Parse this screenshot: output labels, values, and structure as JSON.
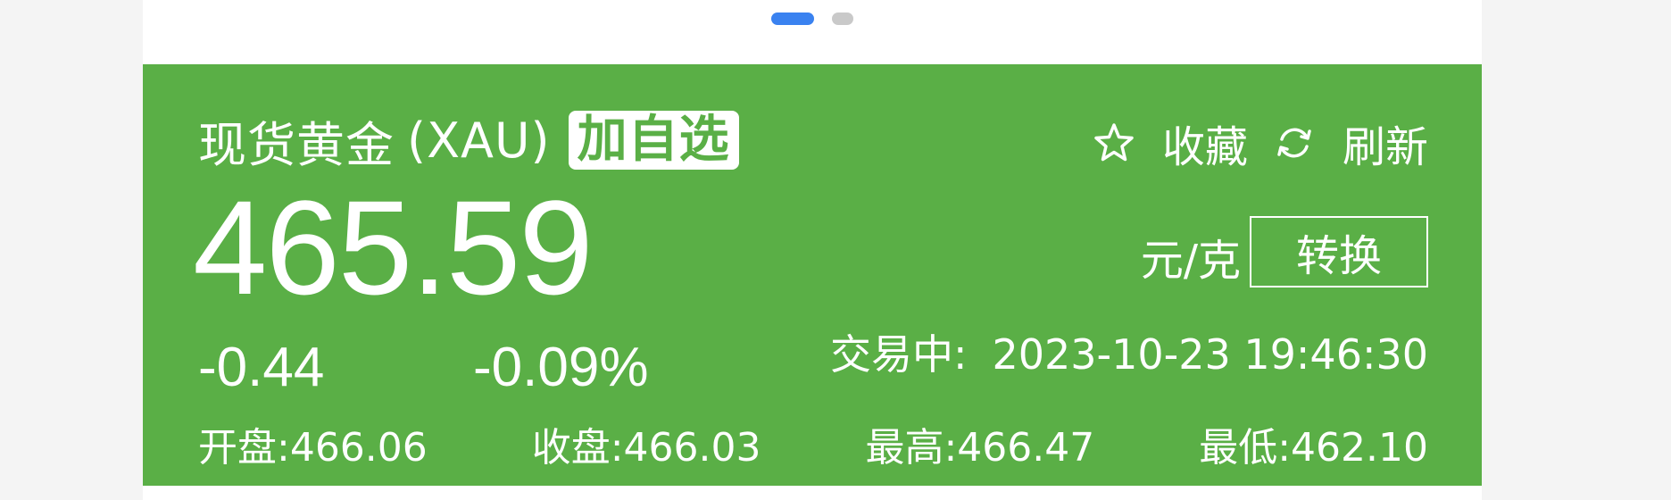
{
  "pager": {
    "pages": 2,
    "active_index": 0,
    "colors": {
      "active": "#3a82f0",
      "inactive": "#c9c9c9"
    }
  },
  "quote": {
    "name": "现货黄金",
    "code": "(XAU)",
    "add_watchlist_label": "加自选",
    "favorite_icon": "star-outline-icon",
    "favorite_label": "收藏",
    "refresh_icon": "refresh-icon",
    "refresh_label": "刷新",
    "price": "465.59",
    "unit": "元/克",
    "convert_label": "转换",
    "change": "-0.44",
    "change_percent": "-0.09%",
    "status_label": "交易中:",
    "timestamp": "2023-10-23 19:46:30",
    "stats": {
      "open": "开盘:466.06",
      "close": "收盘:466.03",
      "high": "最高:466.47",
      "low": "最低:462.10"
    },
    "colors": {
      "panel": "#5aaf46",
      "text": "#ffffff"
    }
  }
}
